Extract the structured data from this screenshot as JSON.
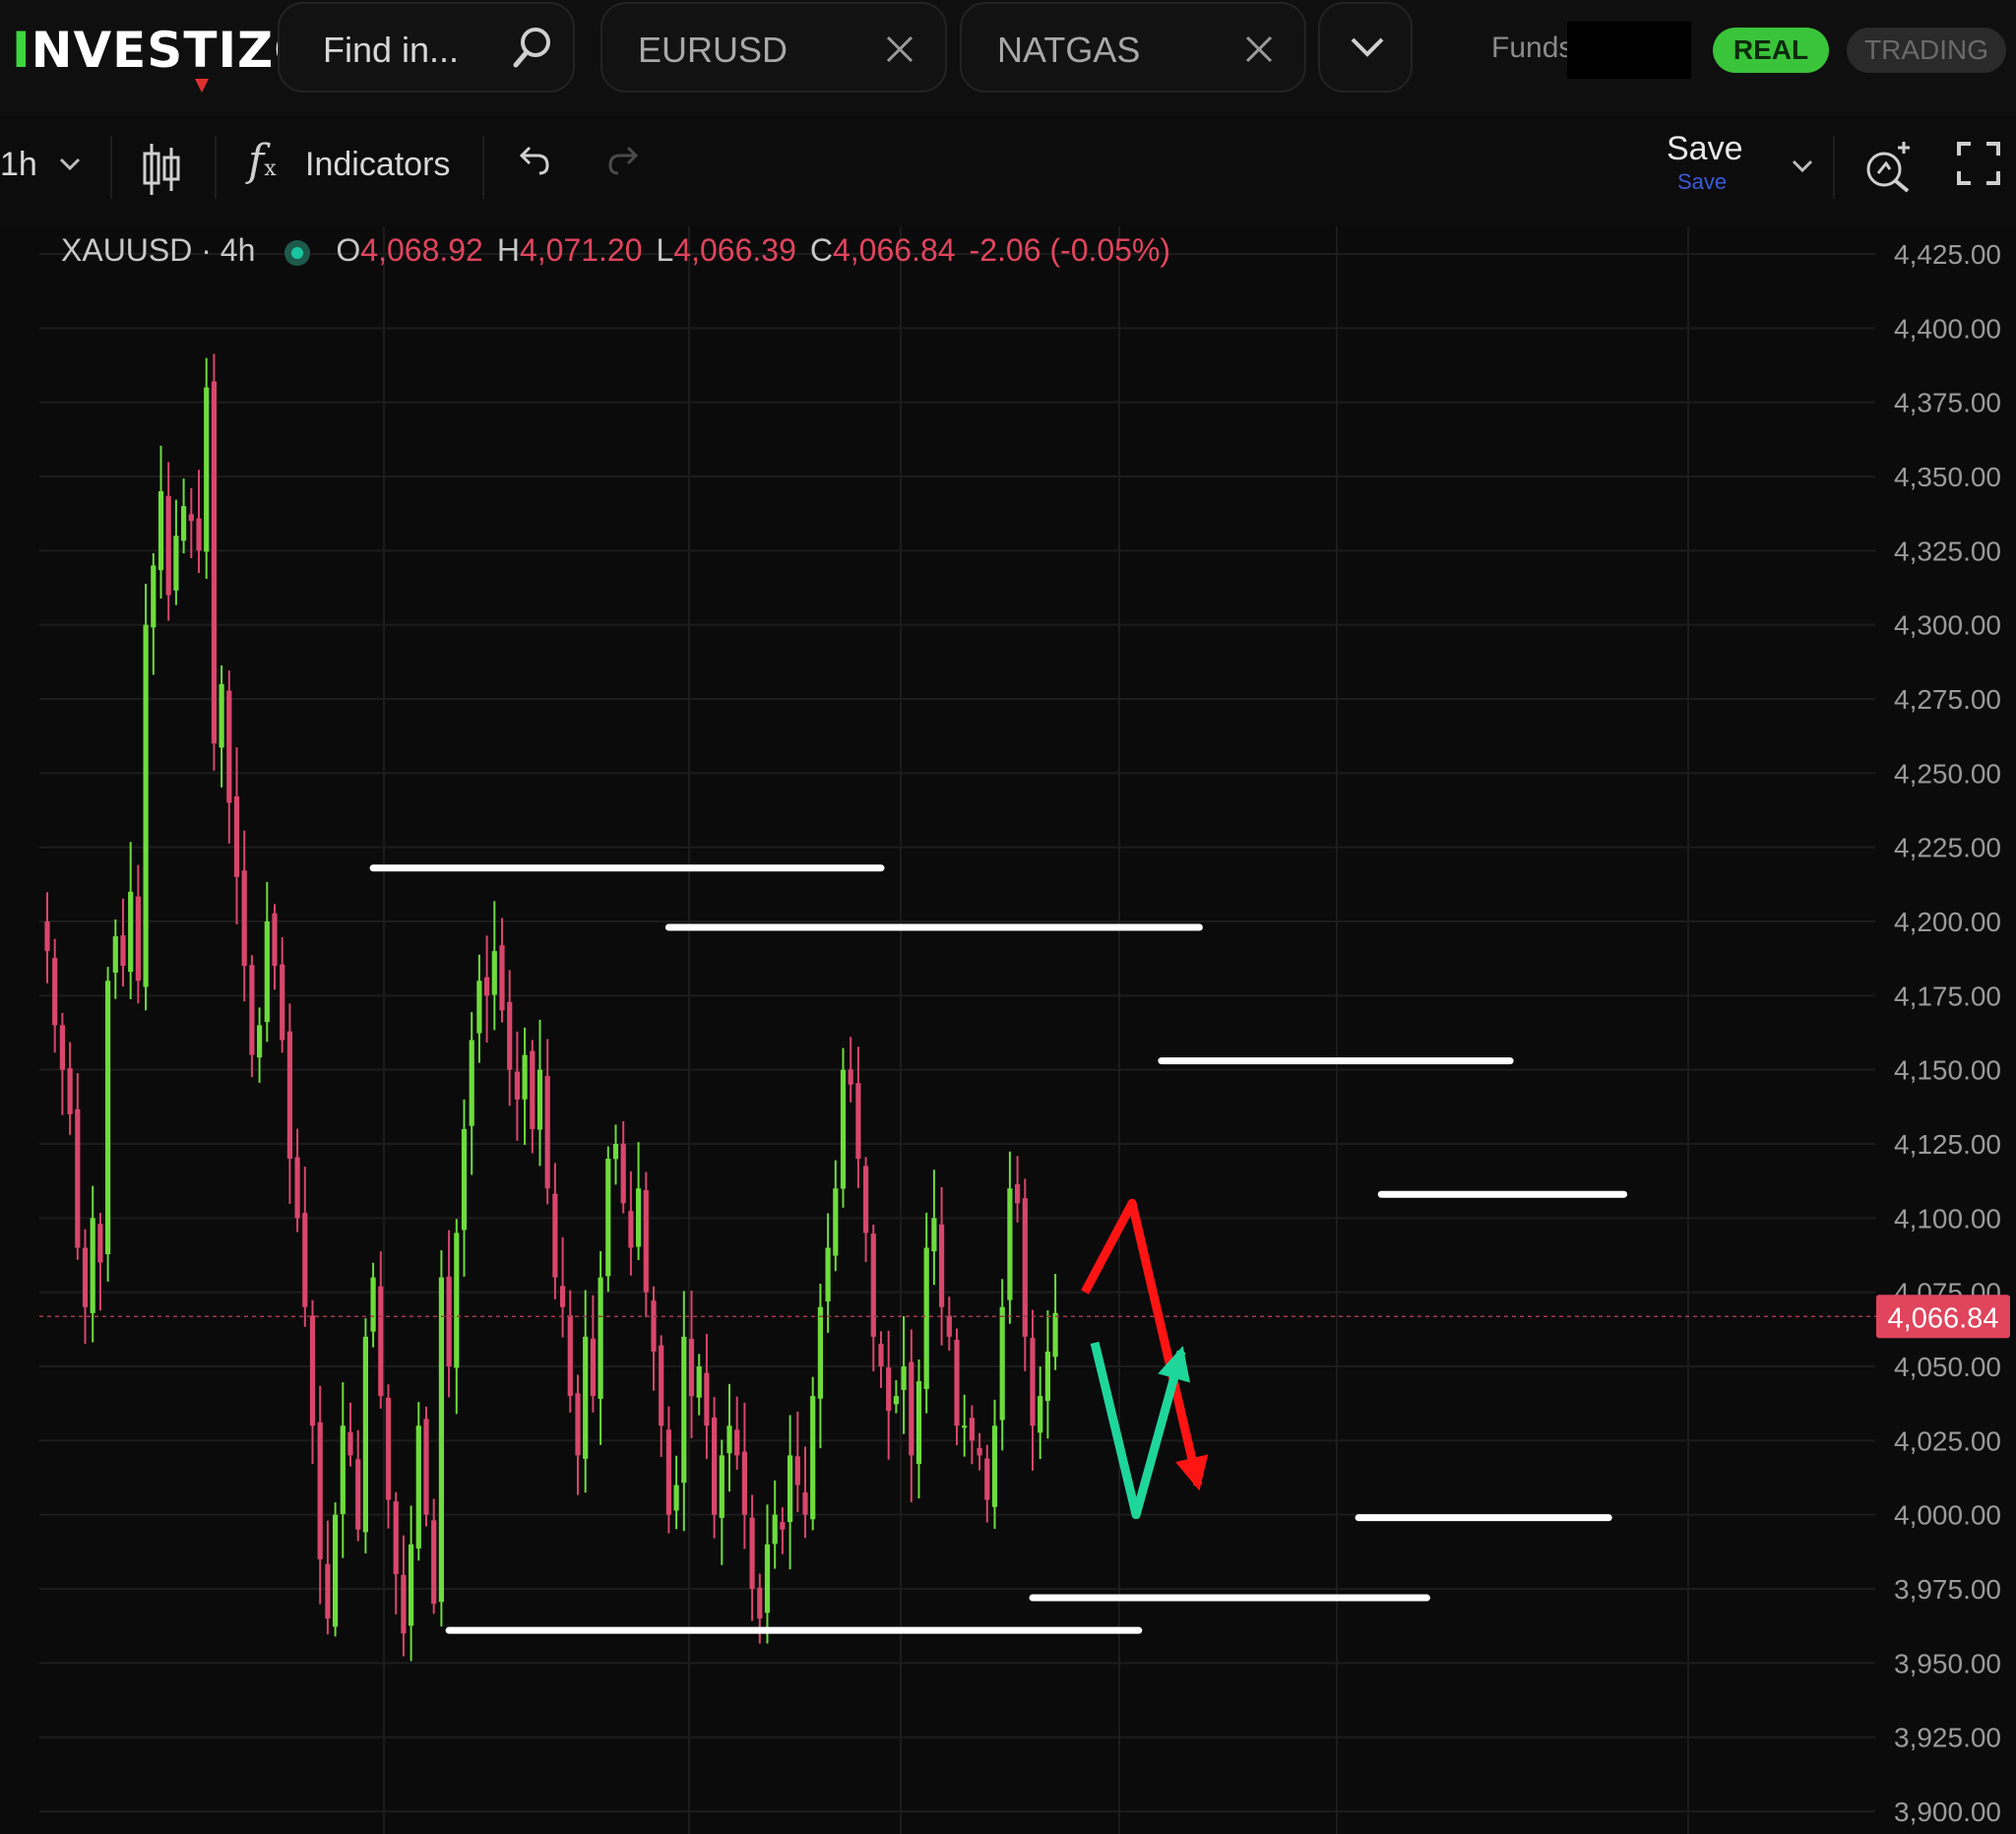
{
  "app": {
    "logo_prefix": "I",
    "logo_mid": "NVES",
    "logo_t": "T",
    "logo_suffix": "IZO"
  },
  "search": {
    "placeholder": "Find in..."
  },
  "tabs": [
    {
      "label": "EURUSD"
    },
    {
      "label": "NATGAS"
    }
  ],
  "account": {
    "funds_label": "Funds",
    "real_label": "REAL",
    "trading_label": "TRADING"
  },
  "toolbar": {
    "timeframe": "1h",
    "indicators_label": "Indicators",
    "save_label": "Save",
    "save_sublabel": "Save"
  },
  "legend": {
    "symbol": "XAUUSD · 4h",
    "o_label": "O",
    "o_value": "4,068.92",
    "h_label": "H",
    "h_value": "4,071.20",
    "l_label": "L",
    "l_value": "4,066.39",
    "c_label": "C",
    "c_value": "4,066.84",
    "change": "-2.06 (-0.05%)"
  },
  "colors": {
    "up": "#6ddc3c",
    "down": "#d9466c",
    "accent_green": "#3ac43a",
    "price_tag": "#e0455d",
    "arrow_red": "#ff1414",
    "arrow_green": "#1fd69a"
  },
  "chart_data": {
    "type": "candlestick",
    "symbol": "XAUUSD",
    "interval": "4h",
    "y_ticks": [
      "4,425.00",
      "4,400.00",
      "4,375.00",
      "4,350.00",
      "4,325.00",
      "4,300.00",
      "4,275.00",
      "4,250.00",
      "4,225.00",
      "4,200.00",
      "4,175.00",
      "4,150.00",
      "4,125.00",
      "4,100.00",
      "4,075.00",
      "4,050.00",
      "4,025.00",
      "4,000.00",
      "3,975.00",
      "3,950.00",
      "3,925.00",
      "3,900.00"
    ],
    "ylim": [
      3900,
      4425
    ],
    "last_price": 4066.84,
    "last_price_label": "4,066.84",
    "grid": true,
    "closes": [
      4190,
      4165,
      4150,
      4135,
      4090,
      4070,
      4100,
      4085,
      4180,
      4195,
      4185,
      4210,
      4180,
      4300,
      4320,
      4345,
      4310,
      4330,
      4340,
      4335,
      4325,
      4380,
      4260,
      4280,
      4240,
      4215,
      4185,
      4155,
      4165,
      4200,
      4185,
      4160,
      4120,
      4100,
      4070,
      4030,
      3985,
      3965,
      4000,
      4030,
      4020,
      3995,
      4060,
      4080,
      4040,
      4005,
      3980,
      3960,
      3990,
      4030,
      4000,
      3970,
      4080,
      4050,
      4095,
      4130,
      4160,
      4180,
      4175,
      4190,
      4170,
      4150,
      4140,
      4155,
      4130,
      4150,
      4110,
      4080,
      4070,
      4040,
      4020,
      4060,
      4040,
      4080,
      4120,
      4125,
      4105,
      4090,
      4110,
      4075,
      4055,
      4030,
      4000,
      4010,
      4060,
      4040,
      4050,
      4030,
      4000,
      4020,
      4030,
      4020,
      4000,
      3975,
      3965,
      3990,
      4000,
      3995,
      4020,
      4010,
      4000,
      4040,
      4070,
      4090,
      4110,
      4150,
      4145,
      4120,
      4095,
      4060,
      4050,
      4035,
      4040,
      4050,
      4020,
      4045,
      4090,
      4100,
      4070,
      4060,
      4030,
      4030,
      4025,
      4020,
      4005,
      4030,
      4070,
      4110,
      4105,
      4060,
      4030,
      4040,
      4055,
      4068
    ]
  },
  "annotations": {
    "levels": [
      {
        "price": 4218,
        "from": 43,
        "to": 110
      },
      {
        "price": 4198,
        "from": 82,
        "to": 152
      },
      {
        "price": 4153,
        "from": 147,
        "to": 193
      },
      {
        "price": 4108,
        "from": 176,
        "to": 208
      },
      {
        "price": 3999,
        "from": 173,
        "to": 206
      },
      {
        "price": 3972,
        "from": 130,
        "to": 182
      },
      {
        "price": 3961,
        "from": 53,
        "to": 144
      }
    ],
    "arrows": [
      {
        "color": "red",
        "kind": "up-down"
      },
      {
        "color": "green",
        "kind": "down-up"
      }
    ]
  }
}
